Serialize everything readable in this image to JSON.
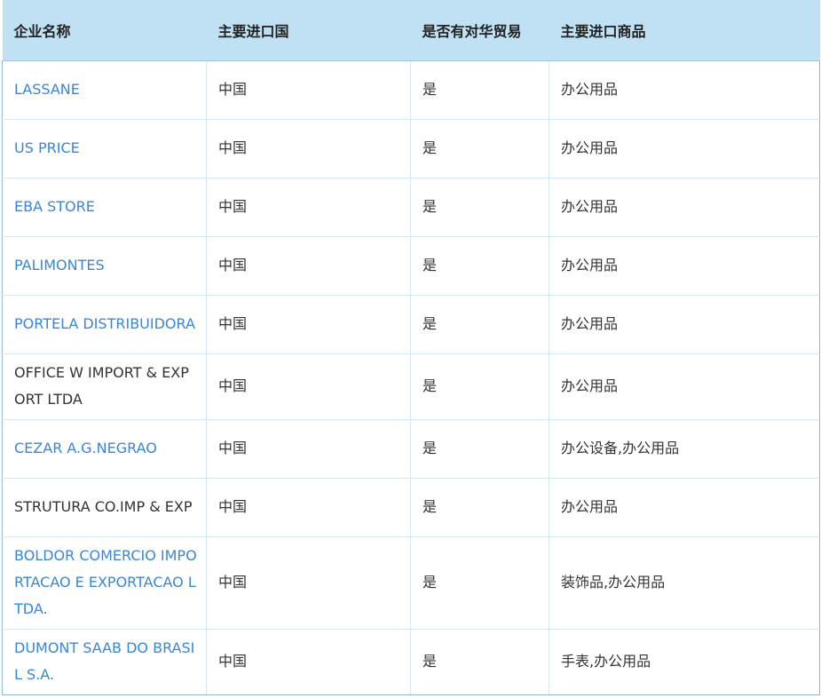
{
  "table": {
    "headers": [
      "企业名称",
      "主要进口国",
      "是否有对华贸易",
      "主要进口商品"
    ],
    "rows": [
      {
        "name": "LASSANE",
        "is_link": true,
        "country": "中国",
        "china_trade": "是",
        "goods": "办公用品"
      },
      {
        "name": "US PRICE",
        "is_link": true,
        "country": "中国",
        "china_trade": "是",
        "goods": "办公用品"
      },
      {
        "name": "EBA STORE",
        "is_link": true,
        "country": "中国",
        "china_trade": "是",
        "goods": "办公用品"
      },
      {
        "name": "PALIMONTES",
        "is_link": true,
        "country": "中国",
        "china_trade": "是",
        "goods": "办公用品"
      },
      {
        "name": "PORTELA DISTRIBUIDORA",
        "is_link": true,
        "country": "中国",
        "china_trade": "是",
        "goods": "办公用品"
      },
      {
        "name": "OFFICE W IMPORT & EXPORT LTDA",
        "is_link": false,
        "country": "中国",
        "china_trade": "是",
        "goods": "办公用品"
      },
      {
        "name": "CEZAR A.G.NEGRAO",
        "is_link": true,
        "country": "中国",
        "china_trade": "是",
        "goods": "办公设备,办公用品"
      },
      {
        "name": "STRUTURA CO.IMP & EXP",
        "is_link": false,
        "country": "中国",
        "china_trade": "是",
        "goods": "办公用品"
      },
      {
        "name": "BOLDOR COMERCIO IMPORTACAO E EXPORTACAO LTDA.",
        "is_link": true,
        "country": "中国",
        "china_trade": "是",
        "goods": "装饰品,办公用品"
      },
      {
        "name": "DUMONT SAAB DO BRASIL S.A.",
        "is_link": true,
        "country": "中国",
        "china_trade": "是",
        "goods": "手表,办公用品"
      }
    ]
  },
  "colors": {
    "header_bg": "#c0e0f4",
    "link": "#3a86d6",
    "text": "#333333",
    "border": "#d7e7f1"
  }
}
